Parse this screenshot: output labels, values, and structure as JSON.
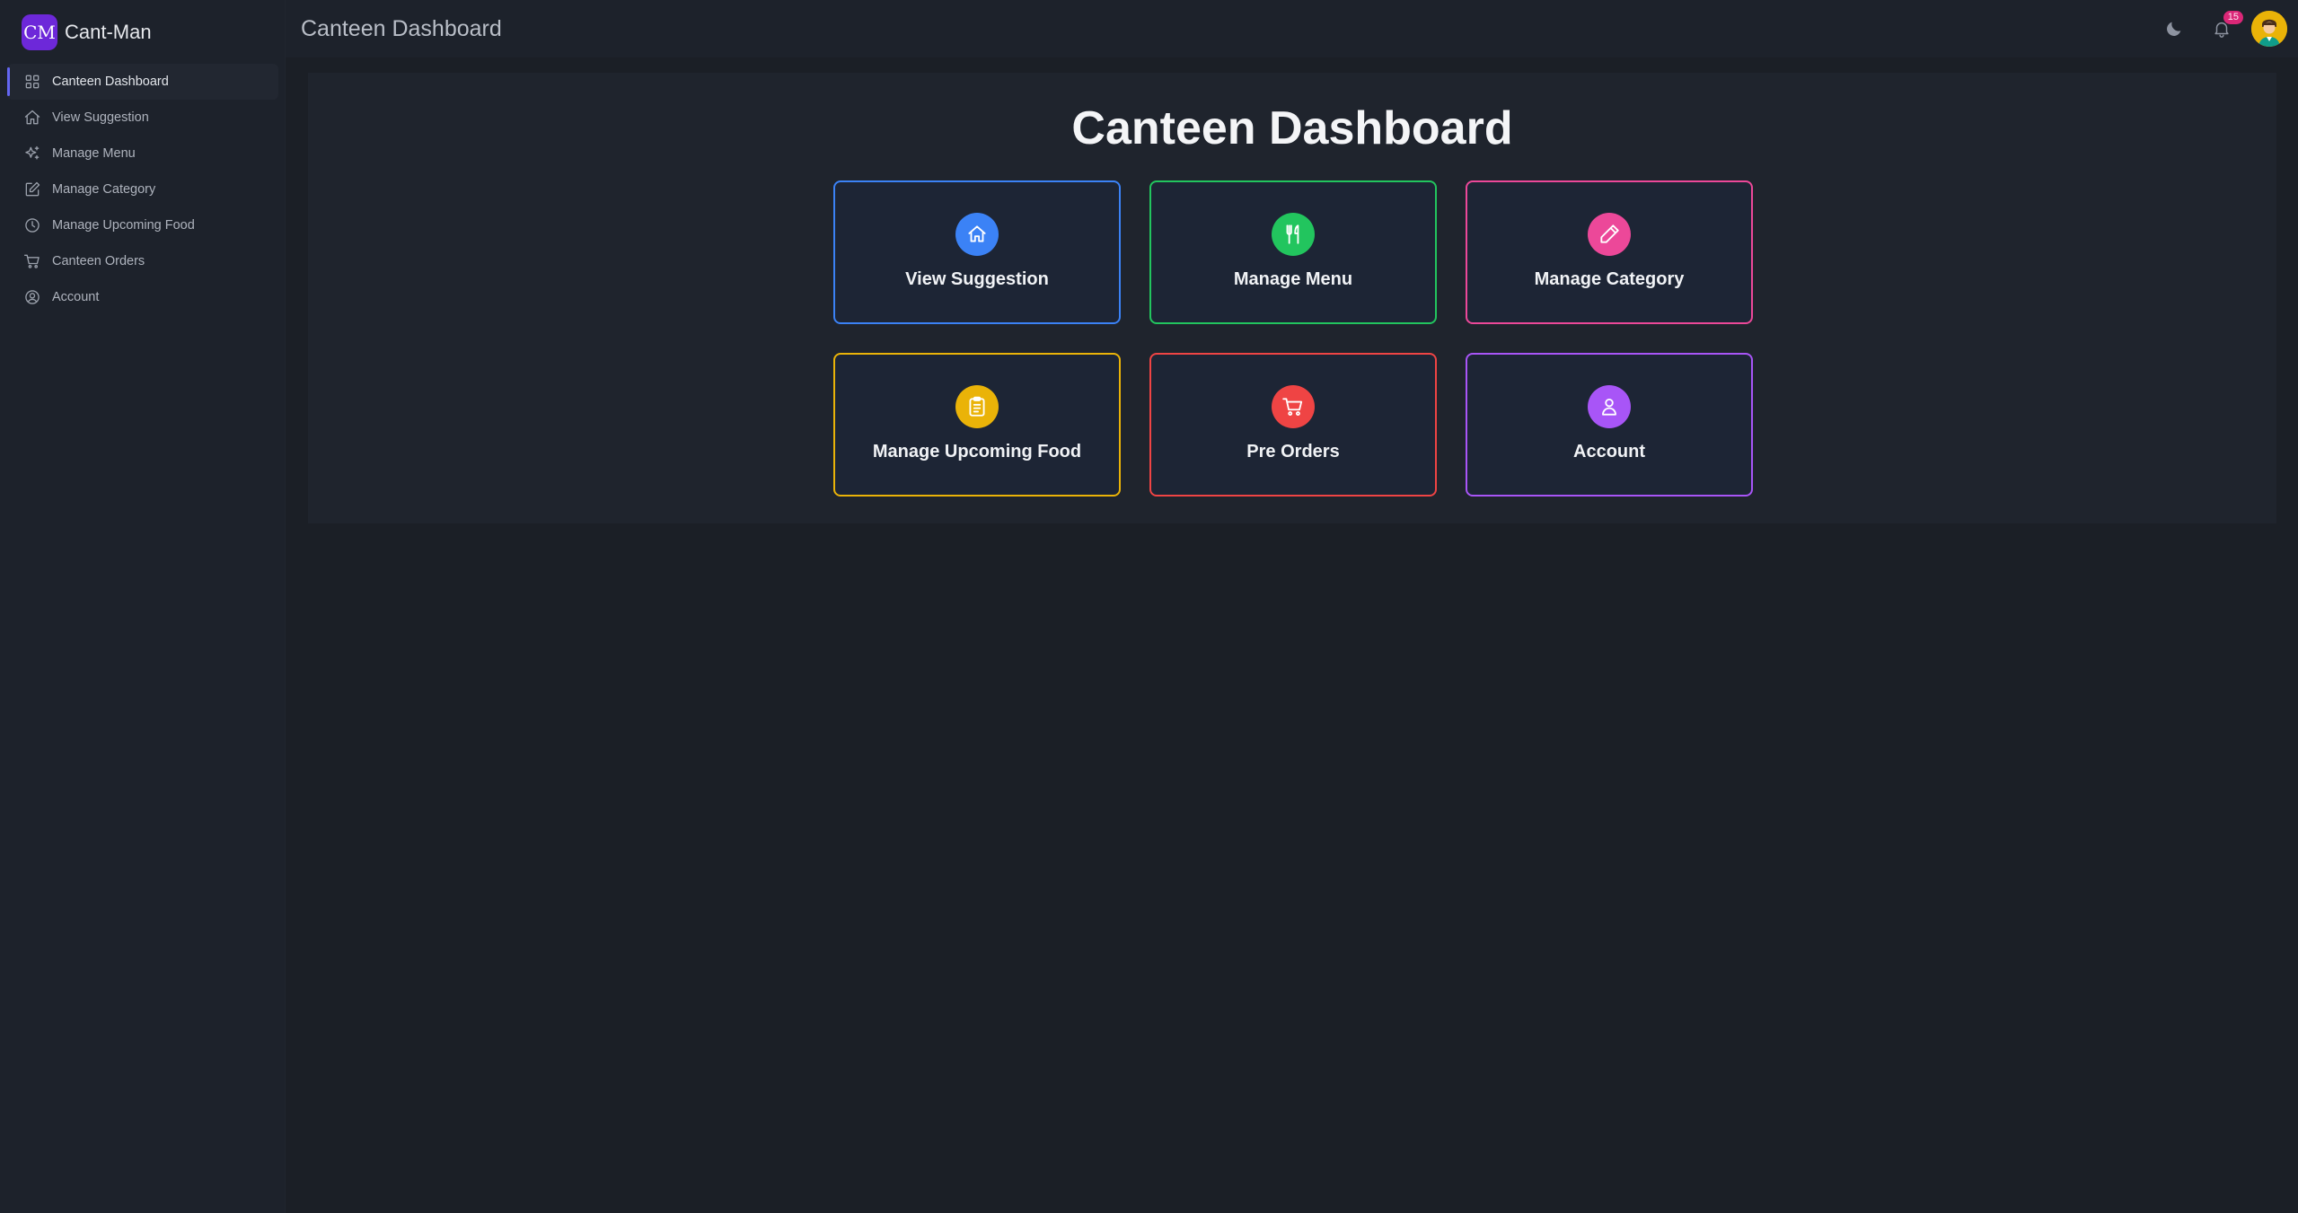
{
  "brand": {
    "logo_text": "CM",
    "name": "Cant-Man"
  },
  "header": {
    "title": "Canteen Dashboard",
    "notification_count": "15"
  },
  "sidebar": {
    "items": [
      {
        "label": "Canteen Dashboard",
        "icon": "grid-icon",
        "active": true
      },
      {
        "label": "View Suggestion",
        "icon": "home-icon"
      },
      {
        "label": "Manage Menu",
        "icon": "sparkles-icon"
      },
      {
        "label": "Manage Category",
        "icon": "edit-icon"
      },
      {
        "label": "Manage Upcoming Food",
        "icon": "clock-icon"
      },
      {
        "label": "Canteen Orders",
        "icon": "cart-icon"
      },
      {
        "label": "Account",
        "icon": "user-circle-icon"
      }
    ]
  },
  "main": {
    "title": "Canteen Dashboard",
    "cards": [
      {
        "label": "View Suggestion",
        "icon": "home-icon",
        "color": "#3b82f6"
      },
      {
        "label": "Manage Menu",
        "icon": "utensils-icon",
        "color": "#22c55e"
      },
      {
        "label": "Manage Category",
        "icon": "pencil-icon",
        "color": "#ec4899"
      },
      {
        "label": "Manage Upcoming Food",
        "icon": "clipboard-icon",
        "color": "#eab308"
      },
      {
        "label": "Pre Orders",
        "icon": "cart-icon",
        "color": "#ef4444"
      },
      {
        "label": "Account",
        "icon": "user-icon",
        "color": "#a855f7"
      }
    ]
  }
}
